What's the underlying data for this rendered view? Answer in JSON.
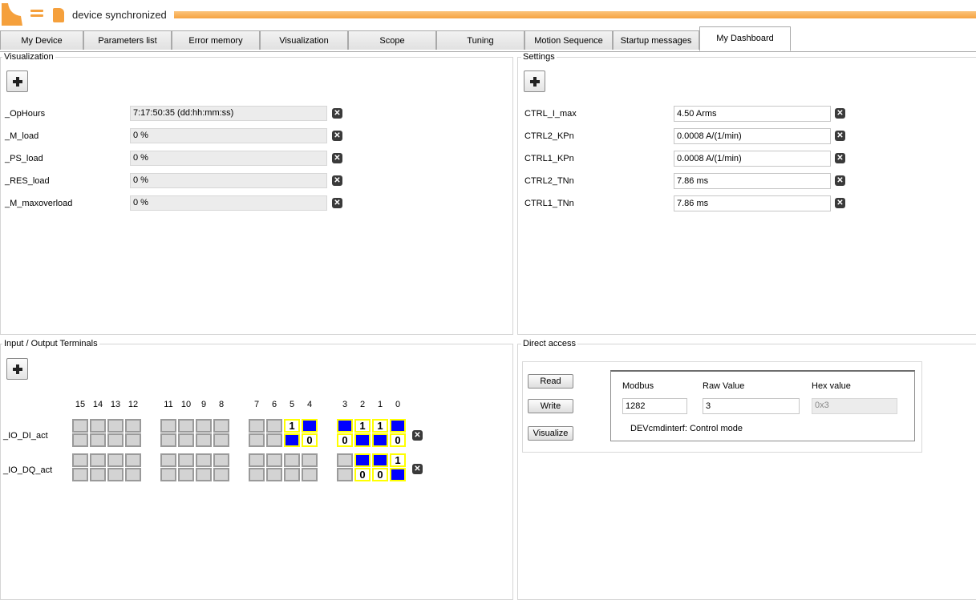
{
  "header": {
    "status": "device synchronized",
    "logo_icon": "shield-logo-icon",
    "menu_icon": "menu-icon",
    "device_icon": "device-icon",
    "accent": "#f5a03c"
  },
  "tabs": [
    {
      "label": "My Device",
      "active": false
    },
    {
      "label": "Parameters list",
      "active": false
    },
    {
      "label": "Error memory",
      "active": false
    },
    {
      "label": "Visualization",
      "active": false
    },
    {
      "label": "Scope",
      "active": false
    },
    {
      "label": "Tuning",
      "active": false
    },
    {
      "label": "Motion Sequence",
      "active": false
    },
    {
      "label": "Startup messages",
      "active": false
    },
    {
      "label": "My Dashboard",
      "active": true
    }
  ],
  "visualization": {
    "title": "Visualization",
    "rows": [
      {
        "label": "_OpHours",
        "value": "7:17:50:35 (dd:hh:mm:ss)"
      },
      {
        "label": "_M_load",
        "value": "0 %"
      },
      {
        "label": "_PS_load",
        "value": "0 %"
      },
      {
        "label": "_RES_load",
        "value": "0 %"
      },
      {
        "label": "_M_maxoverload",
        "value": "0 %"
      }
    ]
  },
  "settings": {
    "title": "Settings",
    "rows": [
      {
        "label": "CTRL_I_max",
        "value": "4.50 Arms"
      },
      {
        "label": "CTRL2_KPn",
        "value": "0.0008 A/(1/min)"
      },
      {
        "label": "CTRL1_KPn",
        "value": "0.0008 A/(1/min)"
      },
      {
        "label": "CTRL2_TNn",
        "value": "7.86 ms"
      },
      {
        "label": "CTRL1_TNn",
        "value": "7.86 ms"
      }
    ]
  },
  "io": {
    "title": "Input / Output Terminals",
    "bit_numbers": [
      "15",
      "14",
      "13",
      "12",
      "11",
      "10",
      "9",
      "8",
      "7",
      "6",
      "5",
      "4",
      "3",
      "2",
      "1",
      "0"
    ],
    "di": {
      "label": "_IO_DI_act",
      "upper": [
        "off",
        "off",
        "off",
        "off",
        "off",
        "off",
        "off",
        "off",
        "off",
        "off",
        "1",
        "on",
        "on",
        "1",
        "1",
        "on"
      ],
      "lower": [
        "off",
        "off",
        "off",
        "off",
        "off",
        "off",
        "off",
        "off",
        "off",
        "off",
        "on",
        "0",
        "0",
        "on",
        "on",
        "0"
      ]
    },
    "dq": {
      "label": "_IO_DQ_act",
      "upper": [
        "off",
        "off",
        "off",
        "off",
        "off",
        "off",
        "off",
        "off",
        "off",
        "off",
        "off",
        "off",
        "off",
        "on",
        "on",
        "1"
      ],
      "lower": [
        "off",
        "off",
        "off",
        "off",
        "off",
        "off",
        "off",
        "off",
        "off",
        "off",
        "off",
        "off",
        "off",
        "0",
        "0",
        "on"
      ]
    }
  },
  "direct_access": {
    "title": "Direct access",
    "read_label": "Read",
    "write_label": "Write",
    "visualize_label": "Visualize",
    "modbus_label": "Modbus",
    "raw_label": "Raw Value",
    "hex_label": "Hex value",
    "modbus_value": "1282",
    "raw_value": "3",
    "hex_value": "0x3",
    "description": "DEVcmdinterf: Control mode"
  }
}
